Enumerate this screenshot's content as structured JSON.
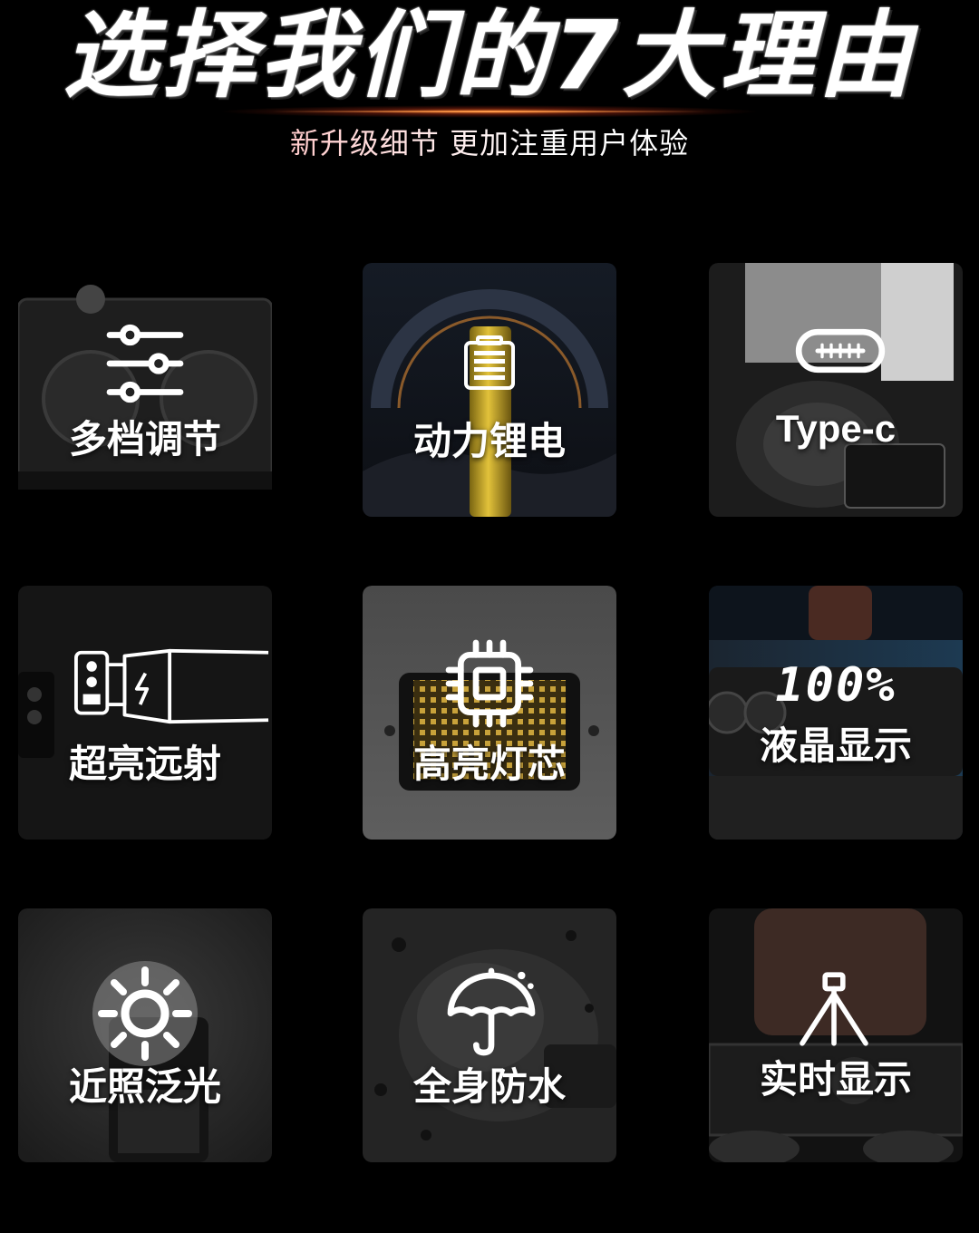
{
  "header": {
    "title": "选择我们的7大理由",
    "subtitle": "新升级细节 更加注重用户体验"
  },
  "features": [
    {
      "label": "多档调节",
      "icon": "sliders-icon"
    },
    {
      "label": "动力锂电",
      "icon": "battery-icon"
    },
    {
      "label": "Type-c",
      "icon": "usb-c-icon"
    },
    {
      "label": "超亮远射",
      "icon": "flashlight-beam-icon"
    },
    {
      "label": "高亮灯芯",
      "icon": "chip-icon"
    },
    {
      "label": "液晶显示",
      "icon": "lcd-display-icon",
      "display_value": "100%"
    },
    {
      "label": "近照泛光",
      "icon": "sun-icon"
    },
    {
      "label": "全身防水",
      "icon": "umbrella-icon"
    },
    {
      "label": "实时显示",
      "icon": "tripod-icon"
    }
  ],
  "colors": {
    "background": "#000000",
    "subtitle_accent": "#ff8c8c",
    "glow": "#ff9a4a"
  }
}
